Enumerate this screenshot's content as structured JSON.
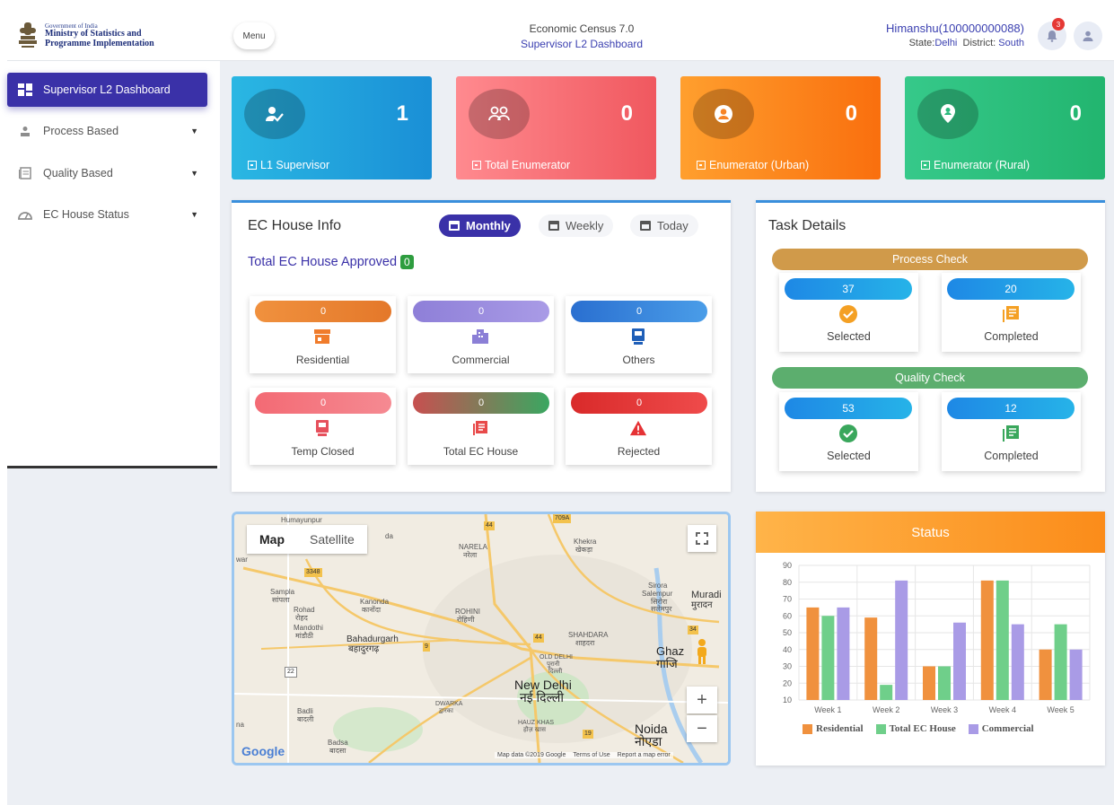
{
  "header": {
    "org_line1": "Government of India",
    "org_line2": "Ministry of Statistics and",
    "org_line3": "Programme Implementation",
    "menu_label": "Menu",
    "title": "Economic Census 7.0",
    "subtitle": "Supervisor L2 Dashboard",
    "user_name": "Himanshu(100000000088)",
    "state_label": "State:",
    "state_value": "Delhi",
    "district_label": "District:",
    "district_value": "South",
    "notification_count": "3"
  },
  "sidebar": {
    "items": [
      {
        "label": "Supervisor L2 Dashboard",
        "icon": "dashboard-icon",
        "active": true
      },
      {
        "label": "Process Based",
        "icon": "user-icon"
      },
      {
        "label": "Quality Based",
        "icon": "list-icon"
      },
      {
        "label": "EC House Status",
        "icon": "gauge-icon"
      }
    ]
  },
  "stats": [
    {
      "value": "1",
      "label": "L1 Supervisor",
      "color_from": "#2ab7e3",
      "color_to": "#1a8fd6"
    },
    {
      "value": "0",
      "label": "Total Enumerator",
      "color_from": "#ff8a8f",
      "color_to": "#f0585f"
    },
    {
      "value": "0",
      "label": "Enumerator (Urban)",
      "color_from": "#ff9f2e",
      "color_to": "#f96f0e"
    },
    {
      "value": "0",
      "label": "Enumerator (Rural)",
      "color_from": "#36c98a",
      "color_to": "#22b56f"
    }
  ],
  "ec_house": {
    "title": "EC House Info",
    "toggles": [
      "Monthly",
      "Weekly",
      "Today"
    ],
    "approved_label": "Total EC House Approved",
    "approved_count": "0",
    "cards": [
      {
        "value": "0",
        "label": "Residential",
        "color": "#ef8e3c"
      },
      {
        "value": "0",
        "label": "Commercial",
        "color": "#9b8ae0"
      },
      {
        "value": "0",
        "label": "Others",
        "color": "#2e7ed6"
      },
      {
        "value": "0",
        "label": "Temp Closed",
        "color": "#f06f7a"
      },
      {
        "value": "0",
        "label": "Total EC House",
        "color": "#3aa761"
      },
      {
        "value": "0",
        "label": "Rejected",
        "color": "#e53235"
      }
    ]
  },
  "task": {
    "title": "Task Details",
    "process_check": "Process Check",
    "quality_check": "Quality Check",
    "process_selected": "37",
    "process_completed": "20",
    "quality_selected": "53",
    "quality_completed": "12",
    "selected_label": "Selected",
    "completed_label": "Completed"
  },
  "map": {
    "tab_map": "Map",
    "tab_satellite": "Satellite",
    "labels": {
      "humayunpur": "Humayunpur",
      "narela": "NARELA",
      "narela_hi": "नरेला",
      "khekra": "Khekra",
      "khekra_hi": "खेकड़ा",
      "sampla": "Sampla",
      "sampla_hi": "सांपला",
      "kanonda": "Kanonda",
      "kanonda_hi": "कानोंदा",
      "rohini": "ROHINI",
      "rohini_hi": "रोहिणी",
      "sirora": "Sirora",
      "salempur": "Salempur",
      "sirora_hi": "सिरोरा",
      "salempur_hi": "सलेमपुर",
      "muradnagar": "Muradi",
      "muradnagar_hi": "मुरादन",
      "rohad": "Rohad",
      "rohad_hi": "रोहद",
      "mandothi": "Mandothi",
      "mandothi_hi": "मांडौठी",
      "bahadurgarh": "Bahadurgarh",
      "bahadurgarh_hi": "बहादुरगढ़",
      "shahdara": "SHAHDARA",
      "shahdara_hi": "शाहदरा",
      "ghaziabad": "Ghaz",
      "ghaziabad_hi": "गाजि",
      "old_delhi": "OLD DELHI",
      "old_delhi_hi": "पुरानी",
      "old_delhi_hi2": "दिल्ली",
      "new_delhi": "New Delhi",
      "new_delhi_hi": "नई दिल्ली",
      "dwarka": "DWARKA",
      "dwarka_hi": "द्वारका",
      "badli": "Badli",
      "badli_hi": "बादली",
      "hauz_khas": "HAUZ KHAS",
      "hauz_khas_hi": "हौज़ खास",
      "noida": "Noida",
      "noida_hi": "नोएडा",
      "badsa": "Badsa",
      "badsa_hi": "बादसा",
      "war": "war",
      "na": "na",
      "da": "da",
      "road_44a": "44",
      "road_3348": "3348",
      "road_44b": "44",
      "road_34": "34",
      "road_9": "9",
      "road_22": "22",
      "road_19": "19",
      "road_709": "709A"
    },
    "attribution": "Map data ©2019 Google",
    "terms": "Terms of Use",
    "report": "Report a map error",
    "google": "Google"
  },
  "status": {
    "title": "Status",
    "legend": [
      "Residential",
      "Total EC House",
      "Commercial"
    ]
  },
  "chart_data": {
    "type": "bar",
    "title": "Status",
    "categories": [
      "Week 1",
      "Week 2",
      "Week 3",
      "Week 4",
      "Week 5"
    ],
    "series": [
      {
        "name": "Residential",
        "color": "#f0913e",
        "values": [
          65,
          59,
          30,
          81,
          40
        ]
      },
      {
        "name": "Total EC House",
        "color": "#6fcf8a",
        "values": [
          60,
          19,
          30,
          81,
          55
        ]
      },
      {
        "name": "Commercial",
        "color": "#a99be6",
        "values": [
          65,
          81,
          56,
          55,
          40
        ]
      }
    ],
    "ylim": [
      10,
      90
    ],
    "yticks": [
      10,
      20,
      30,
      40,
      50,
      60,
      70,
      80,
      90
    ],
    "grid": true,
    "legend_position": "bottom"
  }
}
